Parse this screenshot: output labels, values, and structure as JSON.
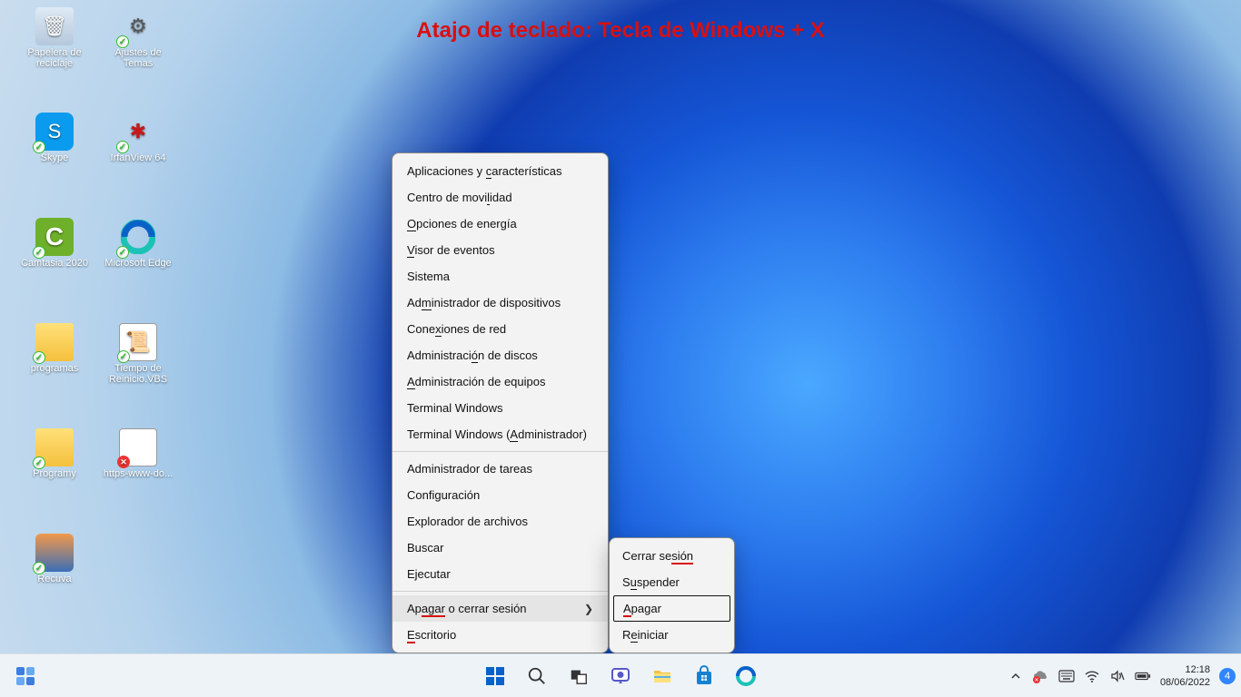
{
  "annotation": "Atajo de teclado: Tecla de Windows + X",
  "desktop_icons": [
    {
      "label": "Papelera de reciclaje",
      "kind": "recycle-bin"
    },
    {
      "label": "Ajustes de Temas",
      "kind": "gear"
    },
    {
      "label": "Skype",
      "kind": "skype"
    },
    {
      "label": "IrfanView 64",
      "kind": "irfan"
    },
    {
      "label": "Camtasia 2020",
      "kind": "camtasia"
    },
    {
      "label": "Microsoft Edge",
      "kind": "edge"
    },
    {
      "label": "programas",
      "kind": "folder"
    },
    {
      "label": "Tiempo de Reinicio.VBS",
      "kind": "vbs"
    },
    {
      "label": "Programy",
      "kind": "folder"
    },
    {
      "label": "https-www-do...",
      "kind": "file-err"
    },
    {
      "label": "Recuva",
      "kind": "recuva"
    }
  ],
  "winx_menu": {
    "items": [
      {
        "pre": "Aplicaciones y ",
        "u": "c",
        "post": "aracterísticas"
      },
      {
        "pre": "Centro de movi",
        "u": "l",
        "post": "idad"
      },
      {
        "pre": "",
        "u": "O",
        "post": "pciones de energía"
      },
      {
        "pre": "",
        "u": "V",
        "post": "isor de eventos"
      },
      {
        "pre": "Sistema",
        "u": "",
        "post": ""
      },
      {
        "pre": "Ad",
        "u": "m",
        "post": "inistrador de dispositivos"
      },
      {
        "pre": "Cone",
        "u": "x",
        "post": "iones de red"
      },
      {
        "pre": "Administraci",
        "u": "ó",
        "post": "n de discos"
      },
      {
        "pre": "",
        "u": "A",
        "post": "dministración de equipos"
      },
      {
        "pre": "Terminal Windows",
        "u": "",
        "post": ""
      },
      {
        "pre": "Terminal Windows (",
        "u": "A",
        "post": "dministrador)"
      },
      {
        "pre": "Administrador de tareas",
        "u": "",
        "post": ""
      },
      {
        "pre": "Configuración",
        "u": "",
        "post": ""
      },
      {
        "pre": "Explorador de archivos",
        "u": "",
        "post": ""
      },
      {
        "pre": "Buscar",
        "u": "",
        "post": ""
      },
      {
        "pre": "Ejecutar",
        "u": "",
        "post": ""
      },
      {
        "pre": "Ap",
        "ur": "agar",
        "post": " o cerrar sesión",
        "sub": true
      },
      {
        "pre": "",
        "ur": "E",
        "post": "scritorio"
      }
    ]
  },
  "submenu": {
    "items": [
      {
        "pre": "Cerrar se",
        "ur": "sión",
        "post": ""
      },
      {
        "pre": "S",
        "u": "u",
        "post": "spender"
      },
      {
        "pre": "",
        "ur": "A",
        "post": "pagar",
        "highlight": true
      },
      {
        "pre": "R",
        "u": "e",
        "post": "iniciar"
      }
    ]
  },
  "systray": {
    "time": "12:18",
    "date": "08/06/2022",
    "notif_count": "4"
  }
}
